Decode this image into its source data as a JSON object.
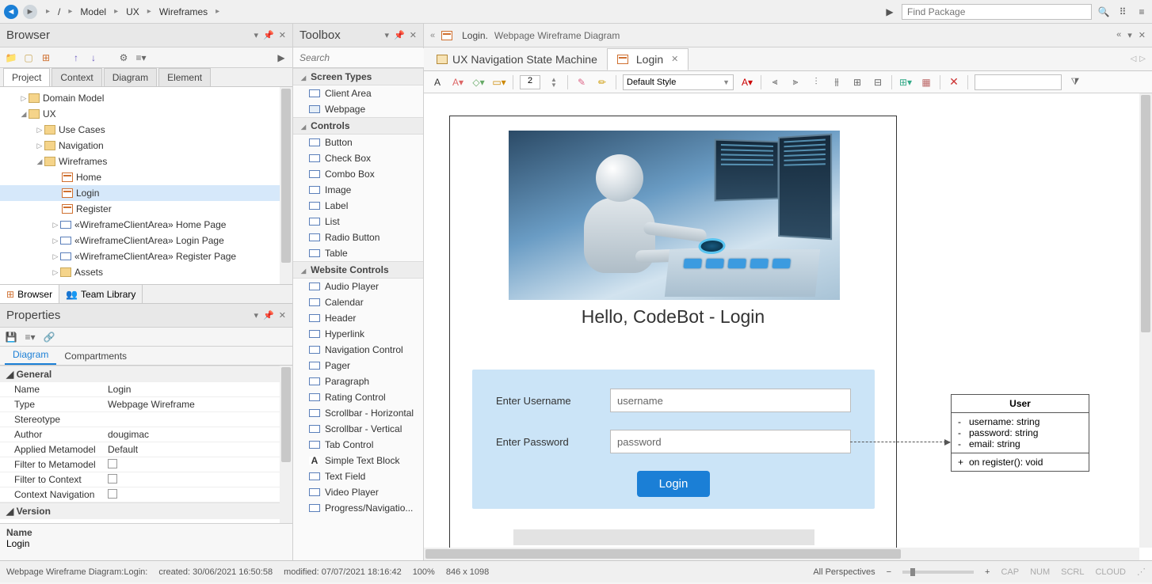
{
  "breadcrumbs": {
    "root": "/",
    "p1": "Model",
    "p2": "UX",
    "p3": "Wireframes"
  },
  "find_package_placeholder": "Find Package",
  "browser": {
    "title": "Browser",
    "tabs": {
      "project": "Project",
      "context": "Context",
      "diagram": "Diagram",
      "element": "Element"
    },
    "tree": {
      "domain_model": "Domain Model",
      "ux": "UX",
      "use_cases": "Use Cases",
      "navigation": "Navigation",
      "wireframes": "Wireframes",
      "home": "Home",
      "login": "Login",
      "register": "Register",
      "home_page": "«WireframeClientArea» Home Page",
      "login_page": "«WireframeClientArea» Login Page",
      "register_page": "«WireframeClientArea» Register Page",
      "assets": "Assets"
    },
    "bottom_tabs": {
      "browser": "Browser",
      "team_library": "Team Library"
    }
  },
  "properties": {
    "title": "Properties",
    "tabs": {
      "diagram": "Diagram",
      "compartments": "Compartments"
    },
    "general": "General",
    "rows": {
      "name_k": "Name",
      "name_v": "Login",
      "type_k": "Type",
      "type_v": "Webpage Wireframe",
      "stereo_k": "Stereotype",
      "stereo_v": "",
      "author_k": "Author",
      "author_v": "dougimac",
      "meta_k": "Applied Metamodel",
      "meta_v": "Default",
      "ftm_k": "Filter to Metamodel",
      "ftc_k": "Filter to Context",
      "cnav_k": "Context Navigation"
    },
    "version": "Version",
    "footer_k": "Name",
    "footer_v": "Login"
  },
  "toolbox": {
    "title": "Toolbox",
    "search_placeholder": "Search",
    "groups": {
      "screen_types": "Screen Types",
      "controls": "Controls",
      "website_controls": "Website Controls"
    },
    "screen_items": {
      "client_area": "Client Area",
      "webpage": "Webpage"
    },
    "control_items": {
      "button": "Button",
      "checkbox": "Check Box",
      "combobox": "Combo Box",
      "image": "Image",
      "label": "Label",
      "list": "List",
      "radio": "Radio Button",
      "table": "Table"
    },
    "website_items": {
      "audio": "Audio Player",
      "calendar": "Calendar",
      "header": "Header",
      "hyperlink": "Hyperlink",
      "navctrl": "Navigation Control",
      "pager": "Pager",
      "paragraph": "Paragraph",
      "rating": "Rating Control",
      "scrollh": "Scrollbar - Horizontal",
      "scrollv": "Scrollbar - Vertical",
      "tabctrl": "Tab Control",
      "textblock": "Simple Text Block",
      "textfield": "Text Field",
      "video": "Video Player",
      "progress": "Progress/Navigatio..."
    }
  },
  "right_header": {
    "doc_name": "Login.",
    "doc_type": "Webpage Wireframe Diagram"
  },
  "doc_tabs": {
    "state": "UX Navigation State Machine",
    "login": "Login"
  },
  "diagram_toolbar": {
    "line_width": "2",
    "style": "Default Style"
  },
  "wireframe": {
    "title": "Hello, CodeBot - Login",
    "username_label": "Enter Username",
    "username_value": "username",
    "password_label": "Enter Password",
    "password_value": "password",
    "login_btn": "Login"
  },
  "user_class": {
    "name": "User",
    "attrs": {
      "u": "username: string",
      "p": "password: string",
      "e": "email: string"
    },
    "op": "on register(): void"
  },
  "status": {
    "left": "Webpage Wireframe Diagram:Login:",
    "created": "created: 30/06/2021 16:50:58",
    "modified": "modified: 07/07/2021 18:16:42",
    "zoom": "100%",
    "dims": "846 x 1098",
    "persp": "All Perspectives",
    "cap": "CAP",
    "num": "NUM",
    "scrl": "SCRL",
    "cloud": "CLOUD"
  }
}
